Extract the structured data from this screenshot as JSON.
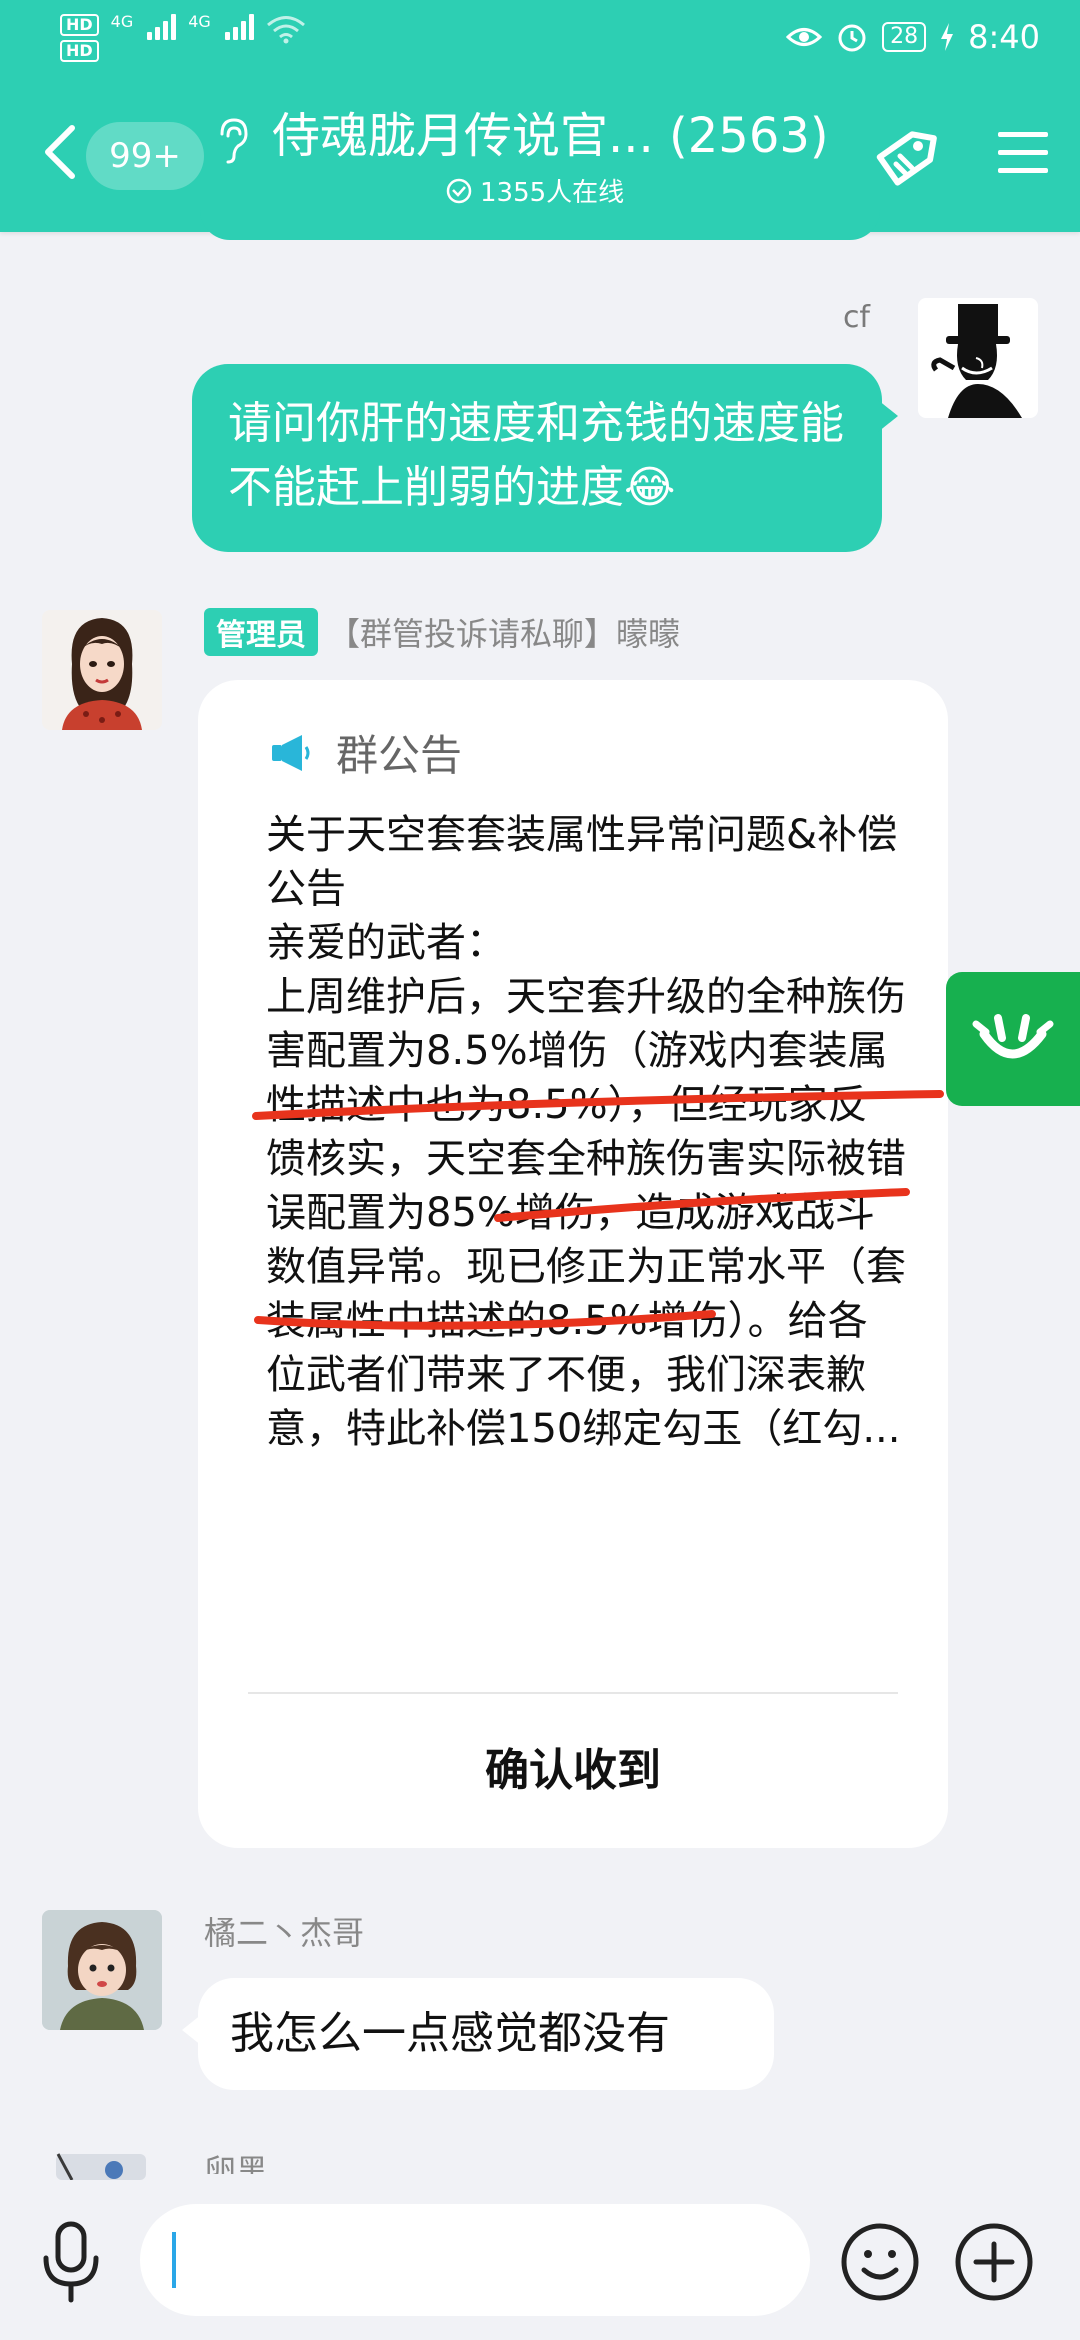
{
  "status_bar": {
    "hd1": "HD",
    "hd2": "HD",
    "net1": "4G",
    "net2": "4G",
    "battery": "28",
    "time": "8:40"
  },
  "header": {
    "unread_badge": "99+",
    "title": "侍魂胧月传说官... (2563)",
    "online_count": "1355人在线",
    "color": "#2dcfb3"
  },
  "messages": [
    {
      "sender": "cf",
      "text": "请问你肝的速度和充钱的速度能不能赶上削弱的进度😂",
      "direction": "out"
    },
    {
      "role_badge": "管理员",
      "sender": "【群管投诉请私聊】曚曚",
      "card_title": "群公告",
      "card_body": "关于天空套套装属性异常问题&补偿公告\n亲爱的武者：\n上周维护后，天空套升级的全种族伤害配置为8.5%增伤（游戏内套装属性描述中也为8.5%），但经玩家反馈核实，天空套全种族伤害实际被错误配置为85%增伤，造成游戏战斗数值异常。现已修正为正常水平（套装属性中描述的8.5%增伤）。给各位武者们带来了不便，我们深表歉意，特此补偿150绑定勾玉（红勾...",
      "confirm_label": "确认收到"
    },
    {
      "sender": "橘二丶杰哥",
      "text": "我怎么一点感觉都没有",
      "direction": "in"
    },
    {
      "sender": "卵黑"
    }
  ],
  "annotation_color": "#e8331c",
  "side_widget_color": "#17b04f"
}
